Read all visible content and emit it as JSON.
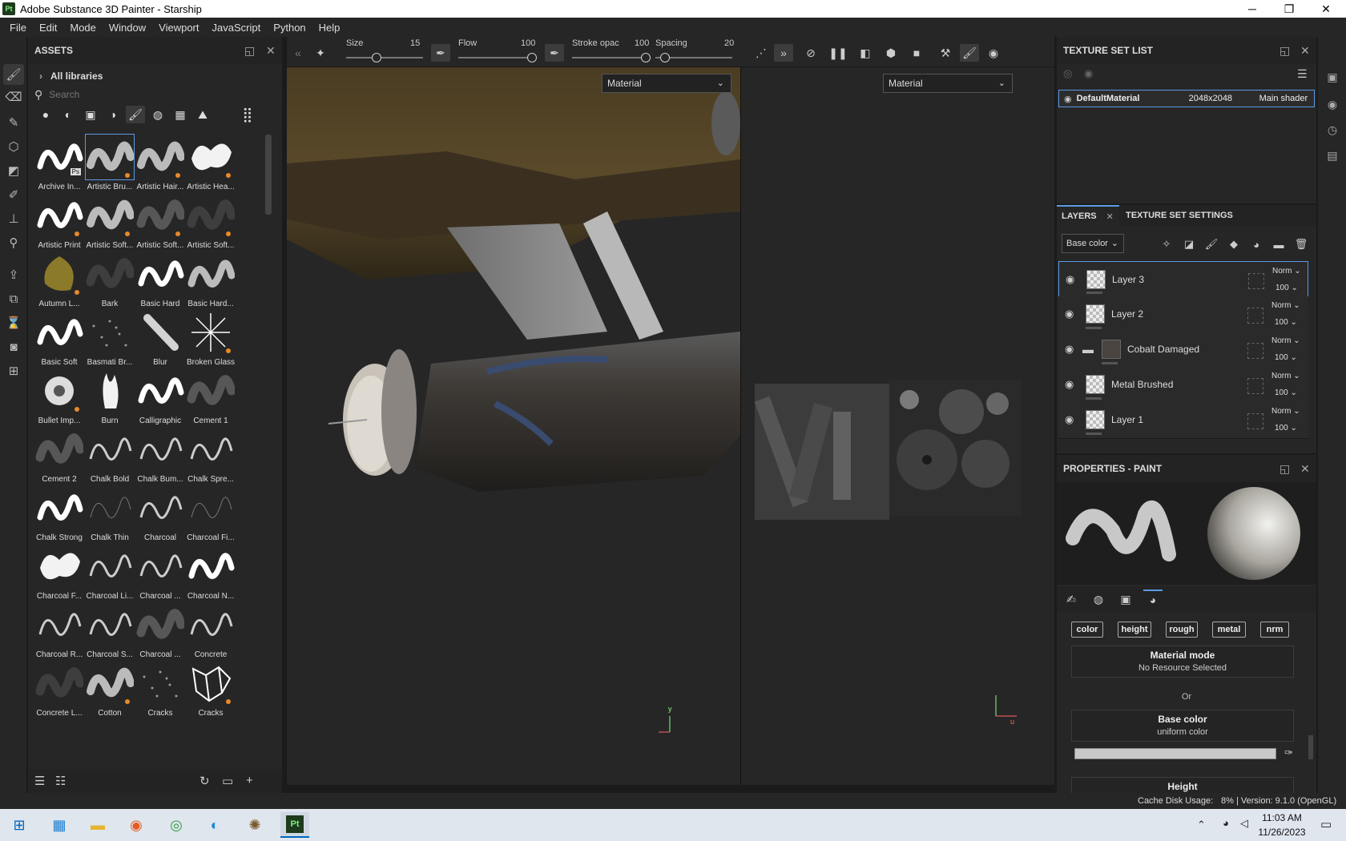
{
  "window": {
    "title": "Adobe Substance 3D Painter - Starship",
    "logo": "Pt",
    "min": "─",
    "max": "❐",
    "close": "✕"
  },
  "menu": [
    "File",
    "Edit",
    "Mode",
    "Window",
    "Viewport",
    "JavaScript",
    "Python",
    "Help"
  ],
  "assets": {
    "title": "ASSETS",
    "libraries": "All libraries",
    "search_placeholder": "Search",
    "brushes": [
      {
        "name": "Archive In...",
        "shape": "s",
        "badge": "Ps"
      },
      {
        "name": "Artistic Bru...",
        "shape": "soft",
        "dot": true,
        "selected": true
      },
      {
        "name": "Artistic Hair...",
        "shape": "soft",
        "dot": true
      },
      {
        "name": "Artistic Hea...",
        "shape": "cloud",
        "dot": true
      },
      {
        "name": "Artistic Print",
        "shape": "s",
        "dot": true
      },
      {
        "name": "Artistic Soft...",
        "shape": "soft",
        "dot": true
      },
      {
        "name": "Artistic Soft...",
        "shape": "faint",
        "dot": true
      },
      {
        "name": "Artistic Soft...",
        "shape": "vfaint",
        "dot": true
      },
      {
        "name": "Autumn L...",
        "shape": "leaf",
        "dot": true
      },
      {
        "name": "Bark",
        "shape": "vfaint"
      },
      {
        "name": "Basic Hard",
        "shape": "s"
      },
      {
        "name": "Basic Hard...",
        "shape": "sgray"
      },
      {
        "name": "Basic Soft",
        "shape": "s"
      },
      {
        "name": "Basmati Br...",
        "shape": "dots"
      },
      {
        "name": "Blur",
        "shape": "blur"
      },
      {
        "name": "Broken Glass",
        "shape": "star",
        "dot": true
      },
      {
        "name": "Bullet Imp...",
        "shape": "bullet",
        "dot": true
      },
      {
        "name": "Burn",
        "shape": "flame"
      },
      {
        "name": "Calligraphic",
        "shape": "s"
      },
      {
        "name": "Cement 1",
        "shape": "faint"
      },
      {
        "name": "Cement 2",
        "shape": "faint"
      },
      {
        "name": "Chalk Bold",
        "shape": "line"
      },
      {
        "name": "Chalk Bum...",
        "shape": "line"
      },
      {
        "name": "Chalk Spre...",
        "shape": "line"
      },
      {
        "name": "Chalk Strong",
        "shape": "s"
      },
      {
        "name": "Chalk Thin",
        "shape": "thin"
      },
      {
        "name": "Charcoal",
        "shape": "line"
      },
      {
        "name": "Charcoal Fi...",
        "shape": "thin"
      },
      {
        "name": "Charcoal F...",
        "shape": "cloud"
      },
      {
        "name": "Charcoal Li...",
        "shape": "line"
      },
      {
        "name": "Charcoal ...",
        "shape": "line"
      },
      {
        "name": "Charcoal N...",
        "shape": "s"
      },
      {
        "name": "Charcoal R...",
        "shape": "line"
      },
      {
        "name": "Charcoal S...",
        "shape": "line"
      },
      {
        "name": "Charcoal ...",
        "shape": "faint"
      },
      {
        "name": "Concrete",
        "shape": "line"
      },
      {
        "name": "Concrete L...",
        "shape": "vfaint"
      },
      {
        "name": "Cotton",
        "shape": "soft",
        "dot": true
      },
      {
        "name": "Cracks",
        "shape": "dots"
      },
      {
        "name": "Cracks",
        "shape": "crack",
        "dot": true
      }
    ]
  },
  "toolbar": {
    "size_label": "Size",
    "size": "15",
    "flow_label": "Flow",
    "flow": "100",
    "stroke_label": "Stroke opac",
    "stroke": "100",
    "spacing_label": "Spacing",
    "spacing": "20"
  },
  "viewport": {
    "left_material": "Material",
    "right_material": "Material"
  },
  "texture_set_list": {
    "title": "TEXTURE SET LIST",
    "row": {
      "name": "DefaultMaterial",
      "size": "2048x2048",
      "shader": "Main shader"
    }
  },
  "layers": {
    "tab1": "LAYERS",
    "tab2": "TEXTURE SET SETTINGS",
    "channel": "Base color",
    "items": [
      {
        "name": "Layer 3",
        "blend": "Norm",
        "opacity": "100",
        "selected": true
      },
      {
        "name": "Layer 2",
        "blend": "Norm",
        "opacity": "100"
      },
      {
        "name": "Cobalt Damaged",
        "blend": "Norm",
        "opacity": "100",
        "folder": true
      },
      {
        "name": "Metal Brushed",
        "blend": "Norm",
        "opacity": "100"
      },
      {
        "name": "Layer 1",
        "blend": "Norm",
        "opacity": "100"
      }
    ]
  },
  "properties": {
    "title": "PROPERTIES - PAINT",
    "channels": [
      "color",
      "height",
      "rough",
      "metal",
      "nrm"
    ],
    "material_mode_title": "Material mode",
    "material_mode_value": "No Resource Selected",
    "or": "Or",
    "base_color_title": "Base color",
    "base_color_value": "uniform color",
    "height_title": "Height"
  },
  "status": {
    "cache": "Cache Disk Usage:",
    "pct": "8% | Version: 9.1.0 (OpenGL)"
  },
  "taskbar": {
    "time": "11:03 AM",
    "date": "11/26/2023"
  }
}
